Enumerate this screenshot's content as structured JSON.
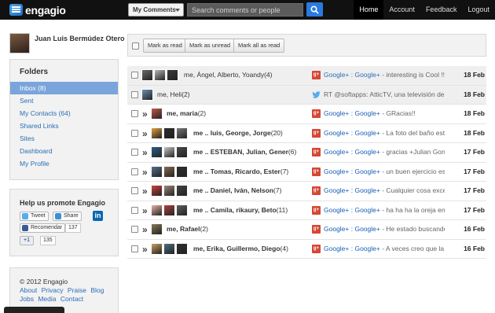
{
  "app": {
    "name": "engagio"
  },
  "header": {
    "filter_label": "My Comments",
    "search_placeholder": "Search comments or people",
    "nav": [
      "Home",
      "Account",
      "Feedback",
      "Logout"
    ]
  },
  "profile": {
    "name": "Juan Luis Bermúdez Otero"
  },
  "folders": {
    "title": "Folders",
    "items": [
      "Inbox (8)",
      "Sent",
      "My Contacts (64)",
      "Shared Links",
      "Sites",
      "Dashboard",
      "My Profile"
    ]
  },
  "promote": {
    "title": "Help us promote Engagio",
    "tweet_label": "Tweet",
    "share_label": "Share",
    "linkedin_label": "in",
    "fb_label": "Recomendar",
    "fb_count": "137",
    "gplus_label": "+1",
    "gplus_count": "135"
  },
  "footer": {
    "copyright": "© 2012 Engagio",
    "links1": [
      "About",
      "Privacy",
      "Praise",
      "Blog"
    ],
    "links2": [
      "Jobs",
      "Media",
      "Contact"
    ]
  },
  "toolbar": {
    "mark_read": "Mark as read",
    "mark_unread": "Mark as unread",
    "mark_all_read": "Mark all as read"
  },
  "colors": {
    "accent": "#2a7ae2",
    "link": "#2a6eb8",
    "selected_folder": "#79a5db",
    "topbar": "#111111"
  },
  "conversations": [
    {
      "people": "me, Ángel, Alberto, Yoandy",
      "count": "(4)",
      "source_icon": "google-plus-icon",
      "source": "Google+ : Google+",
      "snippet": " - interesting is Cool !!",
      "date": "18 Feb",
      "read": true
    },
    {
      "people": "me, Heli",
      "count": "(2)",
      "source_icon": "twitter-icon",
      "source": "",
      "snippet": "RT @softapps: AtticTV, una televisión de v",
      "date": "18 Feb",
      "read": true
    },
    {
      "people": "me, maria",
      "count": "(2)",
      "source_icon": "google-plus-icon",
      "source": "Google+ : Google+",
      "snippet": " - GRacias!!",
      "date": "18 Feb",
      "read": false
    },
    {
      "people": "me .. luis, George, Jorge",
      "count": "(20)",
      "source_icon": "google-plus-icon",
      "source": "Google+ : Google+",
      "snippet": " - La foto del baño est",
      "date": "18 Feb",
      "read": false
    },
    {
      "people": "me .. ESTEBAN, Julian, Gener",
      "count": "(6)",
      "source_icon": "google-plus-icon",
      "source": "Google+ : Google+",
      "snippet": " - gracias +Julian Gon",
      "date": "17 Feb",
      "read": false
    },
    {
      "people": "me .. Tomas, Ricardo, Ester",
      "count": "(7)",
      "source_icon": "google-plus-icon",
      "source": "Google+ : Google+",
      "snippet": " - un buen ejercicio es",
      "date": "17 Feb",
      "read": false
    },
    {
      "people": "me .. Daniel, Iván, Nelson",
      "count": "(7)",
      "source_icon": "google-plus-icon",
      "source": "Google+ : Google+",
      "snippet": " - Cualquier cosa exce",
      "date": "17 Feb",
      "read": false
    },
    {
      "people": "me .. Camila, rikaury, Beto",
      "count": "(11)",
      "source_icon": "google-plus-icon",
      "source": "Google+ : Google+",
      "snippet": " - ha ha ha la oreja en",
      "date": "17 Feb",
      "read": false
    },
    {
      "people": "me, Rafael",
      "count": "(2)",
      "source_icon": "google-plus-icon",
      "source": "Google+ : Google+",
      "snippet": " - He estado buscando",
      "date": "16 Feb",
      "read": false
    },
    {
      "people": "me, Erika, Guillermo, Diego",
      "count": "(4)",
      "source_icon": "google-plus-icon",
      "source": "Google+ : Google+",
      "snippet": " - A veces creo que la",
      "date": "16 Feb",
      "read": false
    }
  ]
}
